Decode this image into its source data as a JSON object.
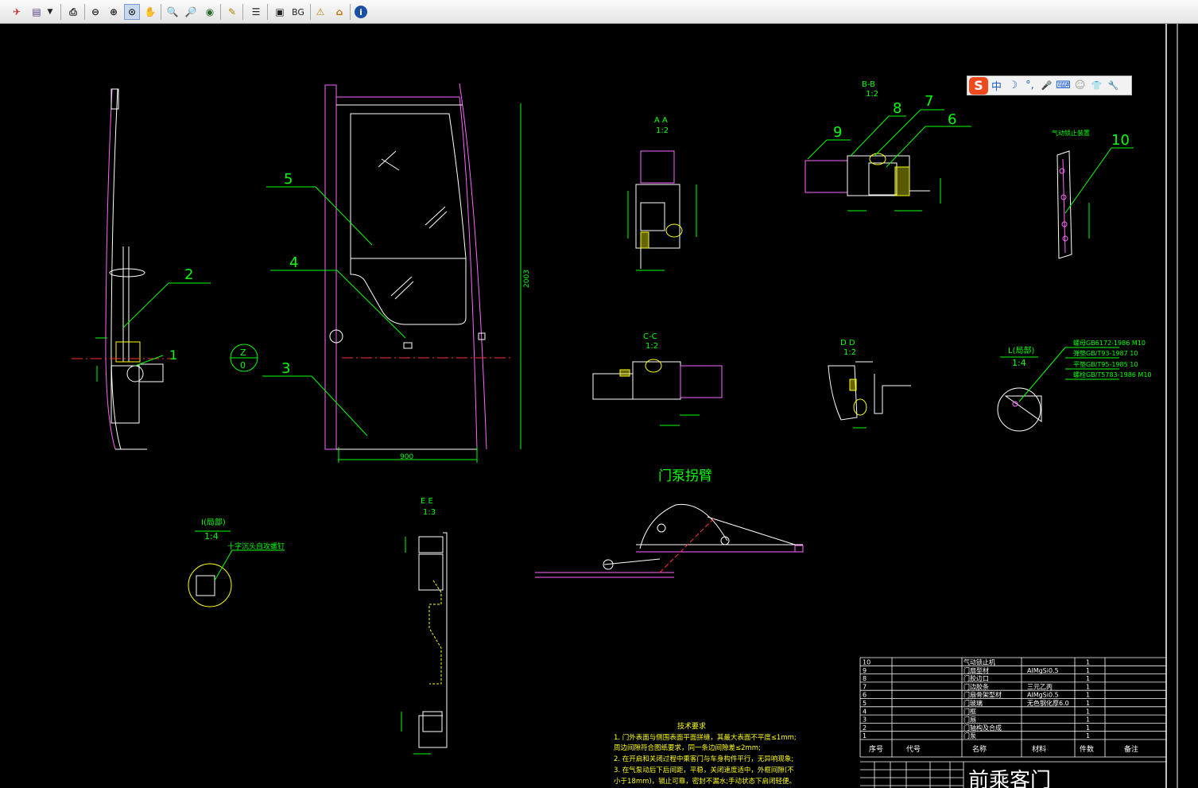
{
  "toolbar": {
    "bg_label": "BG"
  },
  "ime": {
    "logo": "S",
    "lang": "中",
    "moon": "☽",
    "punct": "°,",
    "mic": "🎤",
    "keyboard": "⌨",
    "user": "☺",
    "shirt": "👕",
    "wrench": "🔧"
  },
  "drawing": {
    "door_title": "门泵拐臂",
    "section_aa": "A A",
    "section_bb": "B-B",
    "section_cc": "C-C",
    "section_dd": "D D",
    "section_ee": "E E",
    "scale_12": "1:2",
    "scale_13": "1:3",
    "scale_14": "1:4",
    "detail_l": "L(局部)",
    "detail_i": "I(局部)",
    "note_screw": "十字沉头自攻螺钉",
    "note_lock": "气动锁止装置",
    "dim_height": "2003",
    "dim_width": "900",
    "zone_z": "Z",
    "zone_0": "0",
    "callouts": [
      "1",
      "2",
      "3",
      "4",
      "5",
      "6",
      "7",
      "8",
      "9",
      "10"
    ],
    "fasteners": [
      "螺母GB6172-1986 M10",
      "弹垫GB/T93-1987 10",
      "平垫GB/T95-1985 10",
      "螺栓GB/T5783-1986 M10"
    ],
    "tech_title": "技术要求",
    "tech_lines": [
      "1. 门外表面与侧围表面平面拼缝，其最大表面不平度≤1mm;",
      "   周边间隙符合图纸要求，同一条边间隙差≤2mm;",
      "2. 在开启和关闭过程中乘客门与车身构件平行，无异响现象;",
      "3. 在气泵动后下后间距，平稳，关闭速度适中，外框间隙(不",
      "   小于18mm)，锁止可靠，密封不漏水;手动状态下启闭轻便。"
    ]
  },
  "bom": {
    "rows": [
      {
        "no": "10",
        "name": "气动锁止机",
        "material": "",
        "qty": "1"
      },
      {
        "no": "9",
        "name": "门扇型材",
        "material": "AlMgSi0.5",
        "qty": "1"
      },
      {
        "no": "8",
        "name": "门胶边口",
        "material": "",
        "qty": "1"
      },
      {
        "no": "7",
        "name": "门边胶条",
        "material": "三元乙丙",
        "qty": "1"
      },
      {
        "no": "6",
        "name": "门扇骨架型材",
        "material": "AlMgSi0.5",
        "qty": "1"
      },
      {
        "no": "5",
        "name": "门玻璃",
        "material": "无色钢化厚6.0",
        "qty": "1"
      },
      {
        "no": "4",
        "name": "门框",
        "material": "",
        "qty": "1"
      },
      {
        "no": "3",
        "name": "门扇",
        "material": "",
        "qty": "1"
      },
      {
        "no": "2",
        "name": "门轴构及合成",
        "material": "",
        "qty": "1"
      },
      {
        "no": "1",
        "name": "门泵",
        "material": "",
        "qty": "1"
      }
    ],
    "headers": {
      "no": "序号",
      "code": "代号",
      "name": "名称",
      "material": "材料",
      "qty": "件数",
      "note": "备注"
    },
    "title": "前乘客门"
  }
}
